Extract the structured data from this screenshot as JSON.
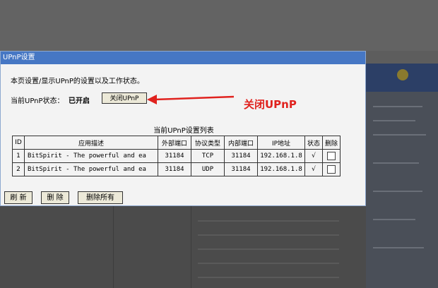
{
  "dialog": {
    "title": "UPnP设置",
    "description": "本页设置/显示UPnP的设置以及工作状态。",
    "status_label": "当前UPnP状态：",
    "status_value": "已开启",
    "close_button": "关闭UPnP",
    "annotation": "关闭UPnP",
    "table_caption": "当前UPnP设置列表",
    "columns": [
      "ID",
      "应用描述",
      "外部端口",
      "协议类型",
      "内部端口",
      "IP地址",
      "状态",
      "删除"
    ],
    "rows": [
      {
        "id": "1",
        "desc": "BitSpirit - The powerful and ea",
        "ext_port": "31184",
        "proto": "TCP",
        "int_port": "31184",
        "ip": "192.168.1.8",
        "state": "√"
      },
      {
        "id": "2",
        "desc": "BitSpirit - The powerful and ea",
        "ext_port": "31184",
        "proto": "UDP",
        "int_port": "31184",
        "ip": "192.168.1.8",
        "state": "√"
      }
    ],
    "buttons": {
      "refresh": "刷 新",
      "delete": "删 除",
      "delete_all": "删除所有"
    }
  },
  "colors": {
    "titlebar": "#4677c4",
    "annotation": "#e0221e"
  }
}
